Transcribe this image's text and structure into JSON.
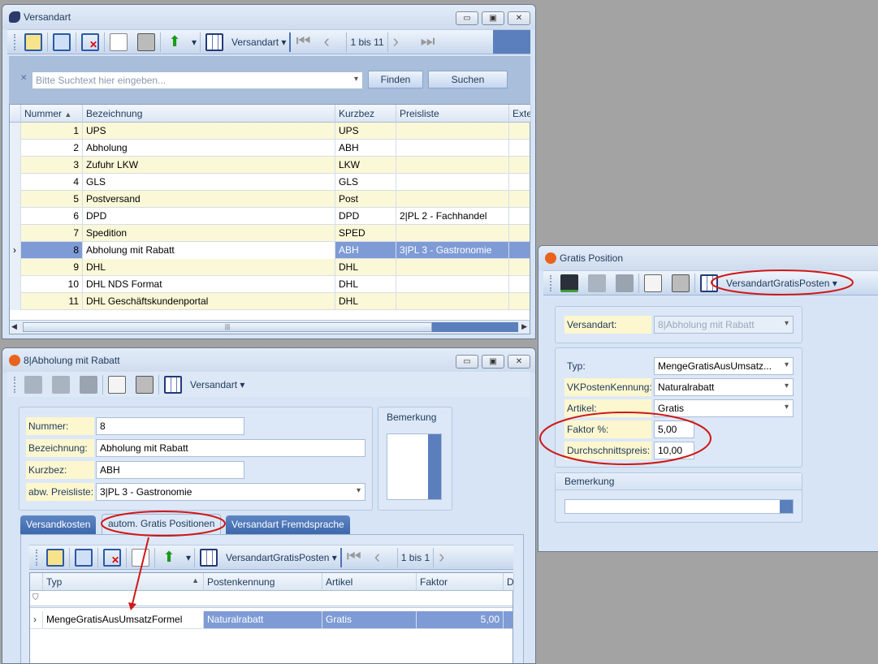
{
  "win_versandart": {
    "title": "Versandart",
    "toolbar": {
      "layout_label": "Versandart",
      "pager": "1 bis 11"
    },
    "search": {
      "placeholder": "Bitte Suchtext hier eingeben...",
      "find_label": "Finden",
      "search_label": "Suchen"
    },
    "columns": [
      "Nummer",
      "Bezeichnung",
      "Kurzbez",
      "Preisliste",
      "Exte"
    ],
    "rows": [
      {
        "nr": "1",
        "bez": "UPS",
        "kurz": "UPS",
        "pl": ""
      },
      {
        "nr": "2",
        "bez": "Abholung",
        "kurz": "ABH",
        "pl": ""
      },
      {
        "nr": "3",
        "bez": "Zufuhr LKW",
        "kurz": "LKW",
        "pl": ""
      },
      {
        "nr": "4",
        "bez": "GLS",
        "kurz": "GLS",
        "pl": ""
      },
      {
        "nr": "5",
        "bez": "Postversand",
        "kurz": "Post",
        "pl": ""
      },
      {
        "nr": "6",
        "bez": "DPD",
        "kurz": "DPD",
        "pl": "2|PL 2 - Fachhandel"
      },
      {
        "nr": "7",
        "bez": "Spedition",
        "kurz": "SPED",
        "pl": ""
      },
      {
        "nr": "8",
        "bez": "Abholung mit Rabatt",
        "kurz": "ABH",
        "pl": "3|PL 3 - Gastronomie"
      },
      {
        "nr": "9",
        "bez": "DHL",
        "kurz": "DHL",
        "pl": ""
      },
      {
        "nr": "10",
        "bez": "DHL NDS Format",
        "kurz": "DHL",
        "pl": ""
      },
      {
        "nr": "11",
        "bez": "DHL Geschäftskundenportal",
        "kurz": "DHL",
        "pl": ""
      }
    ],
    "selected_row": 8
  },
  "win_detail": {
    "title": "8|Abholung mit Rabatt",
    "toolbar": {
      "layout_label": "Versandart"
    },
    "fields": {
      "nummer_label": "Nummer:",
      "nummer": "8",
      "bez_label": "Bezeichnung:",
      "bez": "Abholung mit Rabatt",
      "kurz_label": "Kurzbez:",
      "kurz": "ABH",
      "pl_label": "abw. Preisliste:",
      "pl": "3|PL 3 - Gastronomie"
    },
    "bemerkung_label": "Bemerkung",
    "tabs": [
      "Versandkosten",
      "autom. Gratis Positionen",
      "Versandart Fremdsprache"
    ],
    "active_tab": 1,
    "sub_toolbar": {
      "layout_label": "VersandartGratisPosten",
      "pager": "1 bis 1"
    },
    "sub_columns": [
      "Typ",
      "Postenkennung",
      "Artikel",
      "Faktor",
      "D"
    ],
    "sub_rows": [
      {
        "typ": "MengeGratisAusUmsatzFormel",
        "posten": "Naturalrabatt",
        "artikel": "Gratis",
        "faktor": "5,00"
      }
    ]
  },
  "win_gratis": {
    "title": "Gratis Position",
    "toolbar": {
      "layout_label": "VersandartGratisPosten"
    },
    "versandart_label": "Versandart:",
    "versandart": "8|Abholung mit Rabatt",
    "typ_label": "Typ:",
    "typ": "MengeGratisAusUmsatz...",
    "vk_label": "VKPostenKennung:",
    "vk": "Naturalrabatt",
    "artikel_label": "Artikel:",
    "artikel": "Gratis",
    "faktor_label": "Faktor %:",
    "faktor": "5,00",
    "dsp_label": "Durchschnittspreis:",
    "dsp": "10,00",
    "bemerkung_label": "Bemerkung"
  },
  "colors": {
    "selection": "#7e9bd6",
    "row_alt": "#fbf8d8",
    "annotation": "#d01818"
  }
}
